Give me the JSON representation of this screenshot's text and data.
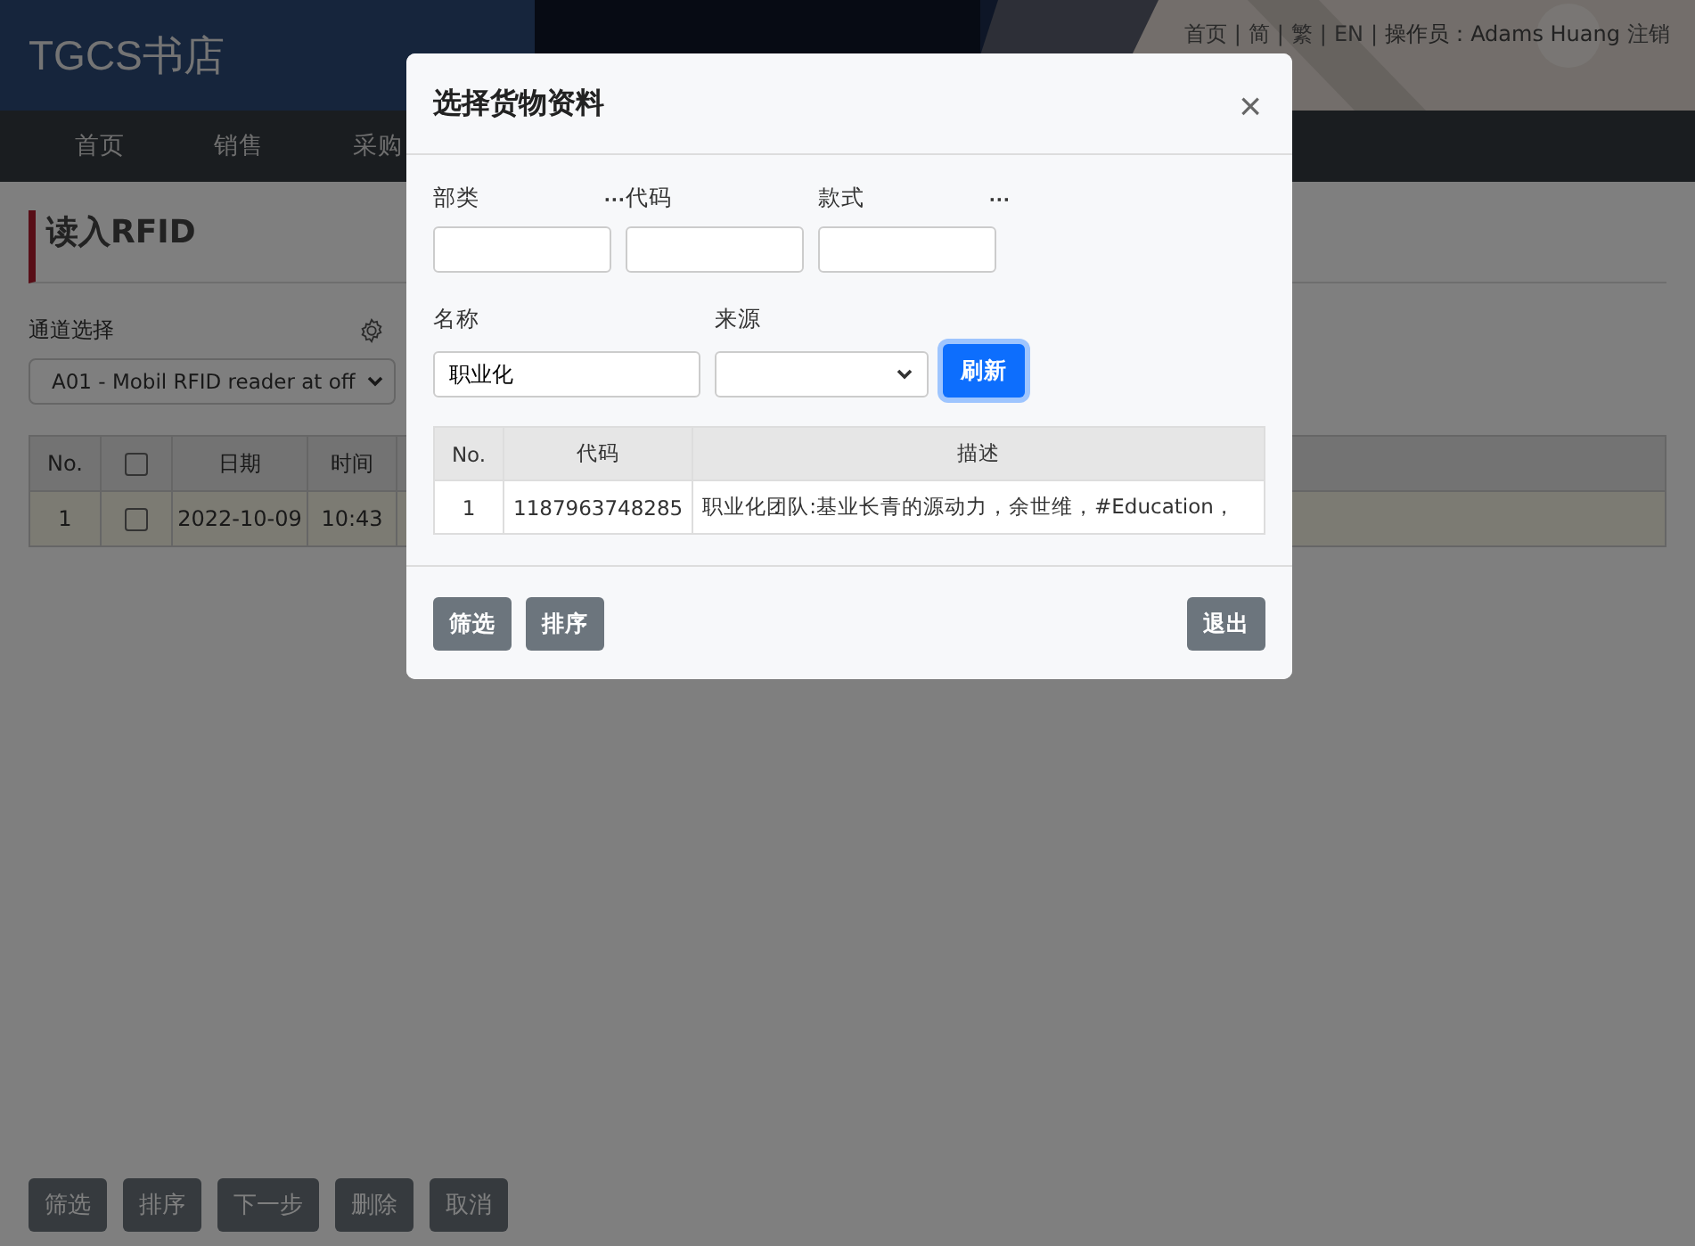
{
  "header": {
    "logo": "TGCS书店",
    "links": [
      {
        "label": "首页",
        "separator": "|"
      },
      {
        "label": "简",
        "separator": "|"
      },
      {
        "label": "繁",
        "separator": "|"
      },
      {
        "label": "EN",
        "separator": "|"
      }
    ],
    "operator": "操作员：Adams Huang",
    "logout": "注销"
  },
  "nav": [
    {
      "label": "首页"
    },
    {
      "label": "销售"
    },
    {
      "label": "采购"
    }
  ],
  "page": {
    "title": "读入RFID",
    "channel_label": "通道选择",
    "channel_value": "A01 - Mobil RFID reader at off",
    "table": {
      "columns": [
        "No.",
        "日期",
        "时间"
      ],
      "rows": [
        {
          "no": "1",
          "checked": false,
          "date": "2022-10-09",
          "time": "10:43"
        }
      ],
      "header_checked": false
    },
    "buttons": [
      "筛选",
      "排序",
      "下一步",
      "删除",
      "取消"
    ]
  },
  "dialog": {
    "title": "选择货物资料",
    "close": "×",
    "fields": [
      {
        "label": "部类",
        "more": "···"
      },
      {
        "label": "代码"
      },
      {
        "label": "款式",
        "more": "···"
      }
    ],
    "name_label": "名称",
    "name_value": "职业化",
    "source_label": "来源",
    "refresh": "刷新",
    "table": {
      "columns": [
        "No.",
        "代码",
        "描述"
      ],
      "rows": [
        {
          "no": "1",
          "code": "1187963748285",
          "desc": "职业化团队:基业长青的源动力，余世维，#Education，"
        }
      ]
    },
    "footer_left": [
      "筛选",
      "排序"
    ],
    "footer_right": "退出"
  }
}
